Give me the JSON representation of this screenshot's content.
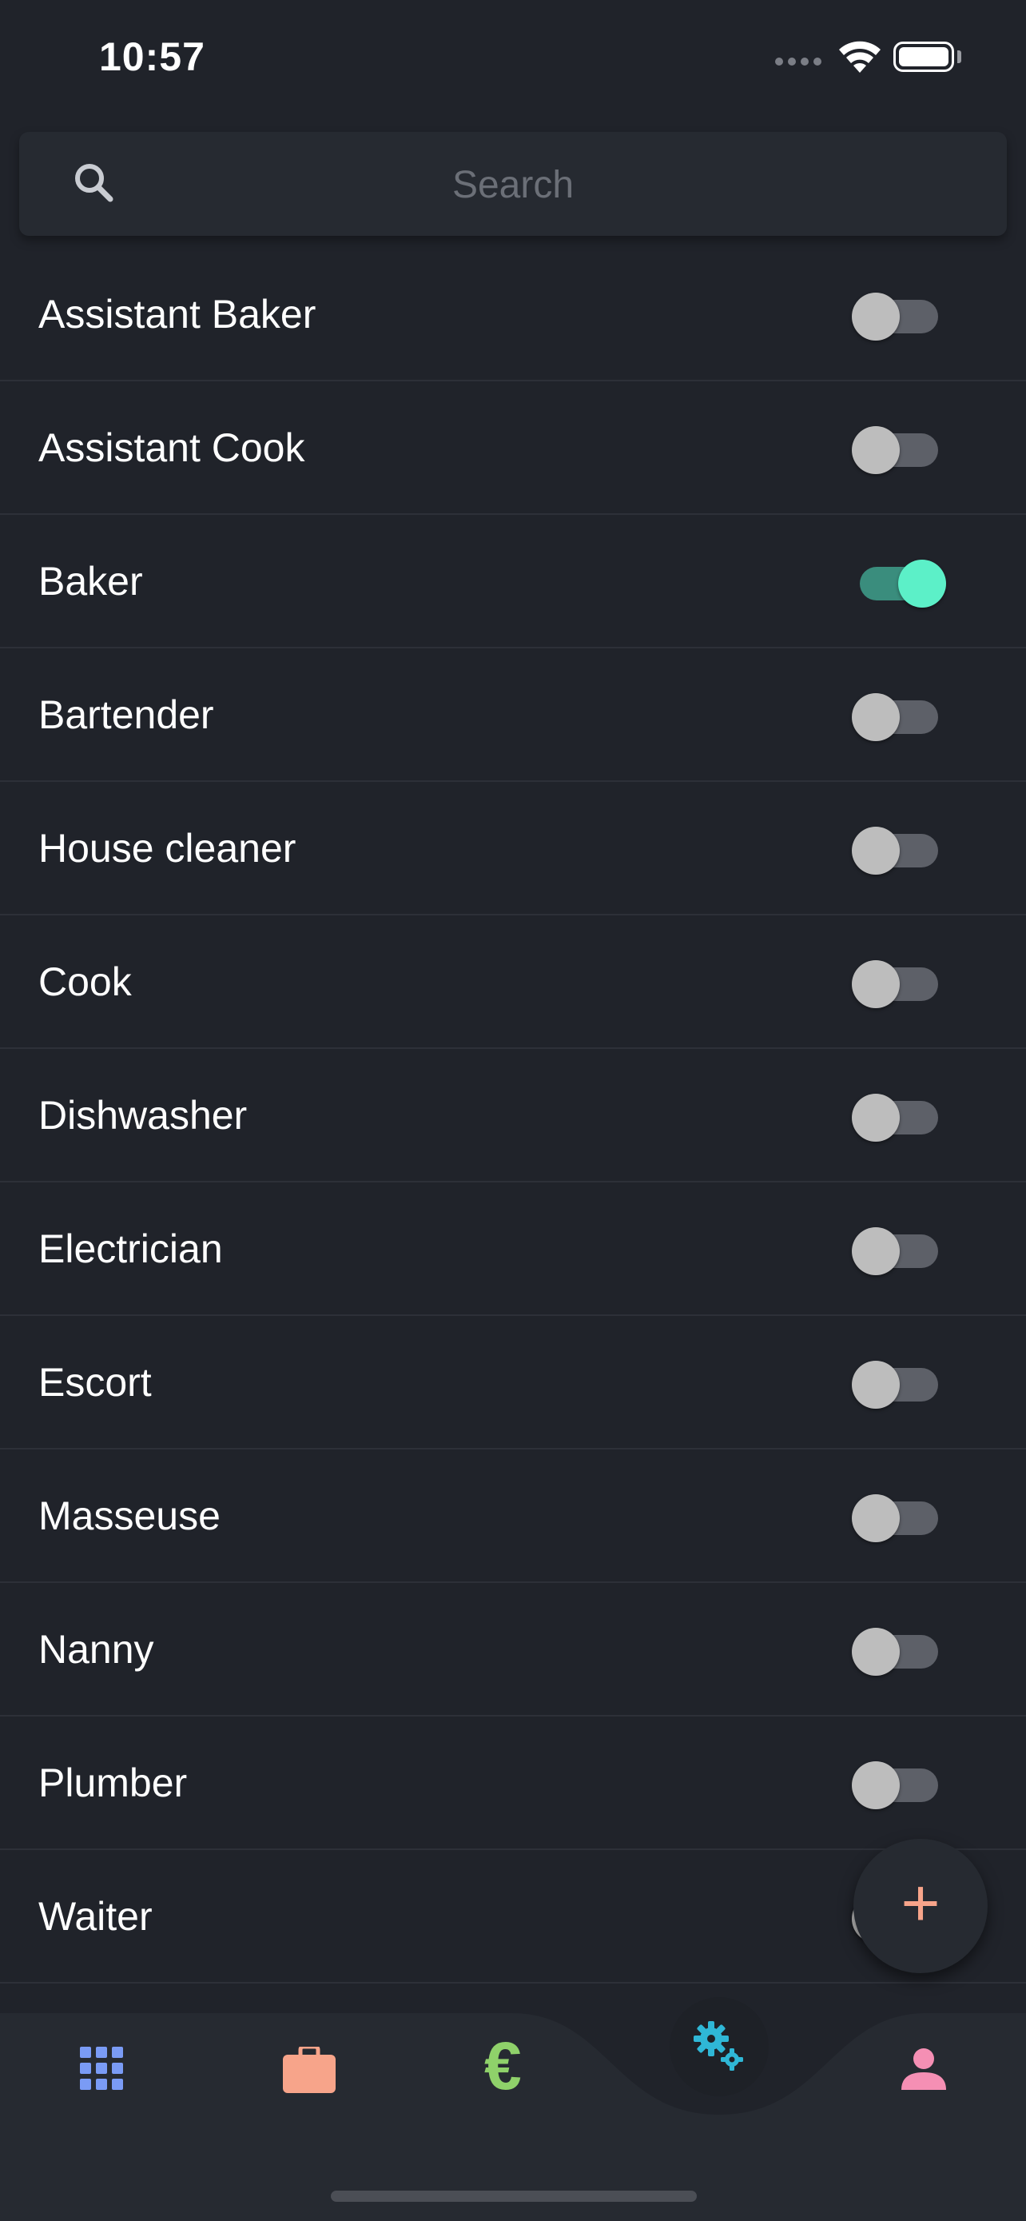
{
  "status_bar": {
    "time": "10:57"
  },
  "search": {
    "placeholder": "Search",
    "value": ""
  },
  "items": [
    {
      "label": "Assistant Baker",
      "enabled": false
    },
    {
      "label": "Assistant Cook",
      "enabled": false
    },
    {
      "label": "Baker",
      "enabled": true
    },
    {
      "label": "Bartender",
      "enabled": false
    },
    {
      "label": "House cleaner",
      "enabled": false
    },
    {
      "label": "Cook",
      "enabled": false
    },
    {
      "label": "Dishwasher",
      "enabled": false
    },
    {
      "label": "Electrician",
      "enabled": false
    },
    {
      "label": "Escort",
      "enabled": false
    },
    {
      "label": "Masseuse",
      "enabled": false
    },
    {
      "label": "Nanny",
      "enabled": false
    },
    {
      "label": "Plumber",
      "enabled": false
    },
    {
      "label": "Waiter",
      "enabled": false
    }
  ],
  "fab": {
    "label": "+"
  },
  "bottom_nav": {
    "items": [
      {
        "icon": "grid-icon",
        "color": "#7a9bf5"
      },
      {
        "icon": "briefcase-icon",
        "color": "#f7a48a"
      },
      {
        "icon": "euro-icon",
        "color": "#8fd16a",
        "label": "€"
      },
      {
        "icon": "gears-icon",
        "color": "#2fb7d6",
        "active": true
      },
      {
        "icon": "person-icon",
        "color": "#f58fb4"
      }
    ]
  },
  "colors": {
    "background": "#20232a",
    "surface": "#262a31",
    "toggle_on": "#5cf0c8",
    "toggle_off": "#bdbdbd"
  }
}
